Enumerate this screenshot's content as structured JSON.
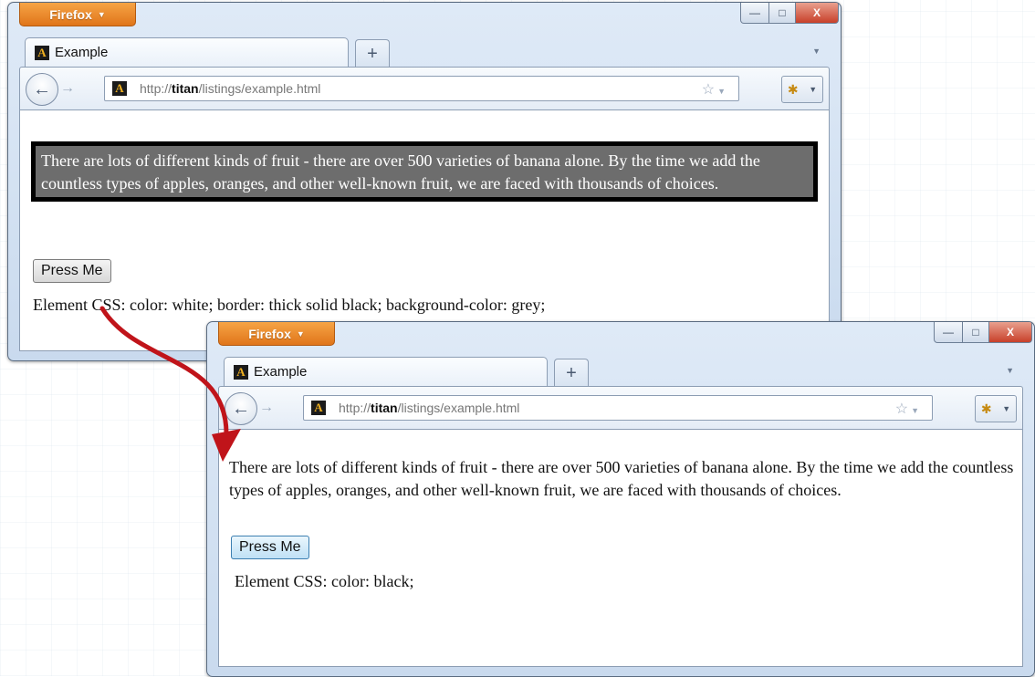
{
  "windows": [
    {
      "menu_label": "Firefox",
      "tab_title": "Example",
      "url_prefix": "http://",
      "url_host": "titan",
      "url_path": "/listings/example.html",
      "paragraph": "There are lots of different kinds of fruit - there are over 500 varieties of banana alone. By the time we add the countless types of apples, oranges, and other well-known fruit, we are faced with thousands of choices.",
      "button_label": "Press Me",
      "css_text": "Element CSS: color: white; border: thick solid black; background-color: grey;"
    },
    {
      "menu_label": "Firefox",
      "tab_title": "Example",
      "url_prefix": "http://",
      "url_host": "titan",
      "url_path": "/listings/example.html",
      "paragraph": "There are lots of different kinds of fruit - there are over 500 varieties of banana alone. By the time we add the countless types of apples, oranges, and other well-known fruit, we are faced with thousands of choices.",
      "button_label": "Press Me",
      "css_text": "Element CSS: color: black;"
    }
  ],
  "colors": {
    "menu_orange": "#e0751a",
    "arrow_red": "#c0141a",
    "styled_background": "#6d6d6d"
  },
  "icons": {
    "favicon_letter": "A",
    "new_tab": "+",
    "back": "←",
    "forward": "→",
    "star": "☆",
    "dropdown": "▼",
    "minimize": "—",
    "maximize": "□",
    "close": "X"
  }
}
